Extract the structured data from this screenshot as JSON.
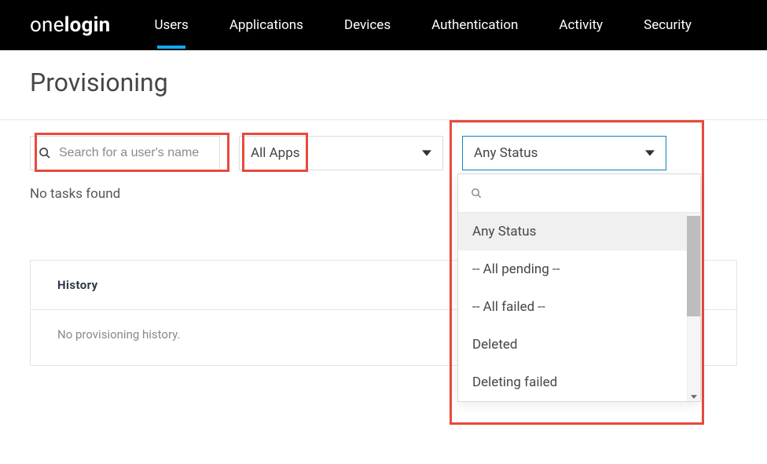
{
  "header": {
    "brand_left": "one",
    "brand_right": "login",
    "nav": [
      "Users",
      "Applications",
      "Devices",
      "Authentication",
      "Activity",
      "Security"
    ],
    "active_nav_index": 0
  },
  "page": {
    "title": "Provisioning"
  },
  "filters": {
    "search_placeholder": "Search for a user's name",
    "app_select_value": "All Apps",
    "status_select_value": "Any Status"
  },
  "empty_text": "No tasks found",
  "history": {
    "heading": "History",
    "empty": "No provisioning history."
  },
  "status_dropdown": {
    "search_value": "",
    "options": [
      "Any Status",
      "-- All pending --",
      "-- All failed --",
      "Deleted",
      "Deleting failed"
    ],
    "selected_index": 0
  }
}
